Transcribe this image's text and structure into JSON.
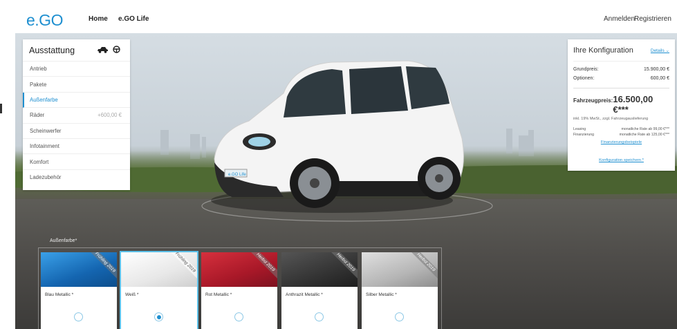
{
  "brand": {
    "logo": "e.GO",
    "accent": "#1e8fd0"
  },
  "nav": {
    "home": "Home",
    "life": "e.GO Life"
  },
  "auth": {
    "login": "Anmelden",
    "register": "Registrieren"
  },
  "ausstattung": {
    "title": "Ausstattung",
    "icons": [
      "car-icon",
      "steering-wheel-icon"
    ],
    "items": [
      {
        "label": "Antrieb",
        "price": ""
      },
      {
        "label": "Pakete",
        "price": ""
      },
      {
        "label": "Außenfarbe",
        "price": "",
        "active": true
      },
      {
        "label": "Räder",
        "price": "+600,00 €"
      },
      {
        "label": "Scheinwerfer",
        "price": ""
      },
      {
        "label": "Infotainment",
        "price": ""
      },
      {
        "label": "Komfort",
        "price": ""
      },
      {
        "label": "Ladezubehör",
        "price": ""
      }
    ]
  },
  "konfiguration": {
    "title": "Ihre Konfiguration",
    "details": "Details ⌄",
    "grundpreis_label": "Grundpreis:",
    "grundpreis": "15.900,00 €",
    "optionen_label": "Optionen:",
    "optionen": "600,00 €",
    "fahrzeugpreis_label": "Fahrzeugpreis:",
    "fahrzeugpreis": "16.500,00 €***",
    "note": "inkl. 19% MwSt., zzgl. Fahrzeugauslieferung",
    "leasing_label": "Leasing",
    "leasing_value": "monatliche Rate ab 99,00 €***",
    "finanzierung_label": "Finanzierung",
    "finanzierung_value": "monatliche Rate ab 125,00 €***",
    "link1": "Finanzierungsbeispiele",
    "link2": "Konfiguration speichern *"
  },
  "aussenfarbe": {
    "label": "Außenfarbe*",
    "options": [
      {
        "name": "Blau Metallic *",
        "ribbon": "Frühling 2019",
        "color": "#1d7fc8",
        "selected": false
      },
      {
        "name": "Weiß *",
        "ribbon": "Frühling 2019",
        "color": "#f0f0f0",
        "selected": true
      },
      {
        "name": "Rot Metallic *",
        "ribbon": "Herbst 2019",
        "color": "#b01e2e",
        "selected": false
      },
      {
        "name": "Anthrazit Metallic *",
        "ribbon": "Herbst 2019",
        "color": "#3a3a3a",
        "selected": false
      },
      {
        "name": "Silber Metallic *",
        "ribbon": "Herbst 2019",
        "color": "#b5b5b5",
        "selected": false
      }
    ]
  },
  "car": {
    "plate": "e.GO Life",
    "color": "#f4f4f4"
  }
}
